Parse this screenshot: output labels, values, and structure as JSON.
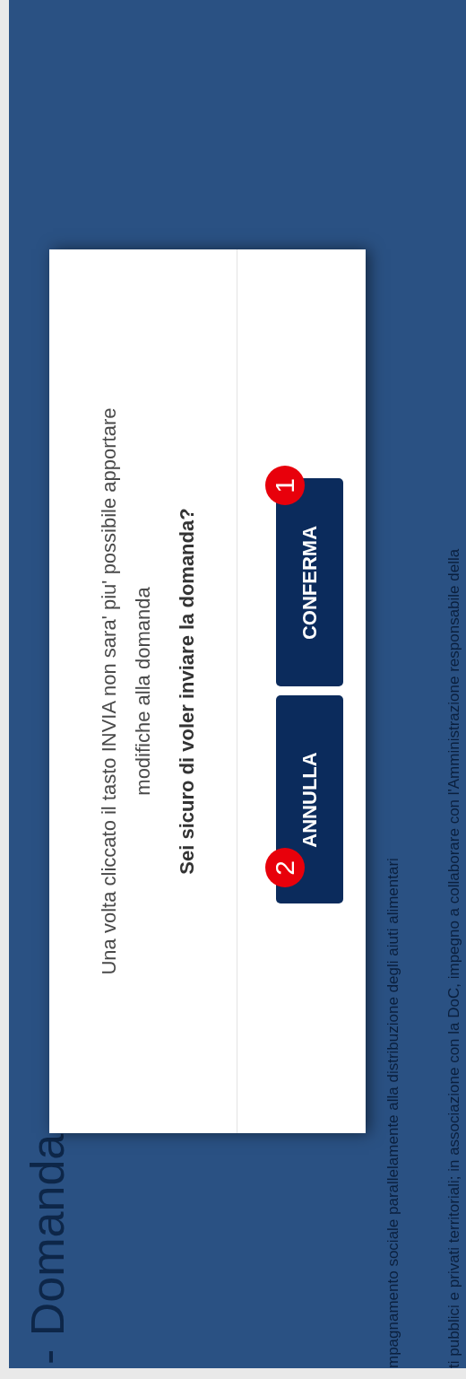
{
  "page": {
    "title": "- Domanda",
    "body_lines": [
      "mpagnamento sociale parallelamente alla distribuzione degli aiuti alimentari",
      "ti pubblici e privati territoriali; in associazione con la DoC, impegno a collaborare con l'Amministrazione responsabile della"
    ]
  },
  "dialog": {
    "message": "Una volta cliccato il tasto INVIA non sara' piu' possibile apportare modifiche alla domanda",
    "question": "Sei sicuro di voler inviare la domanda?",
    "buttons": [
      {
        "label": "ANNULLA",
        "marker": "2"
      },
      {
        "label": "CONFERMA",
        "marker": "1"
      }
    ]
  }
}
